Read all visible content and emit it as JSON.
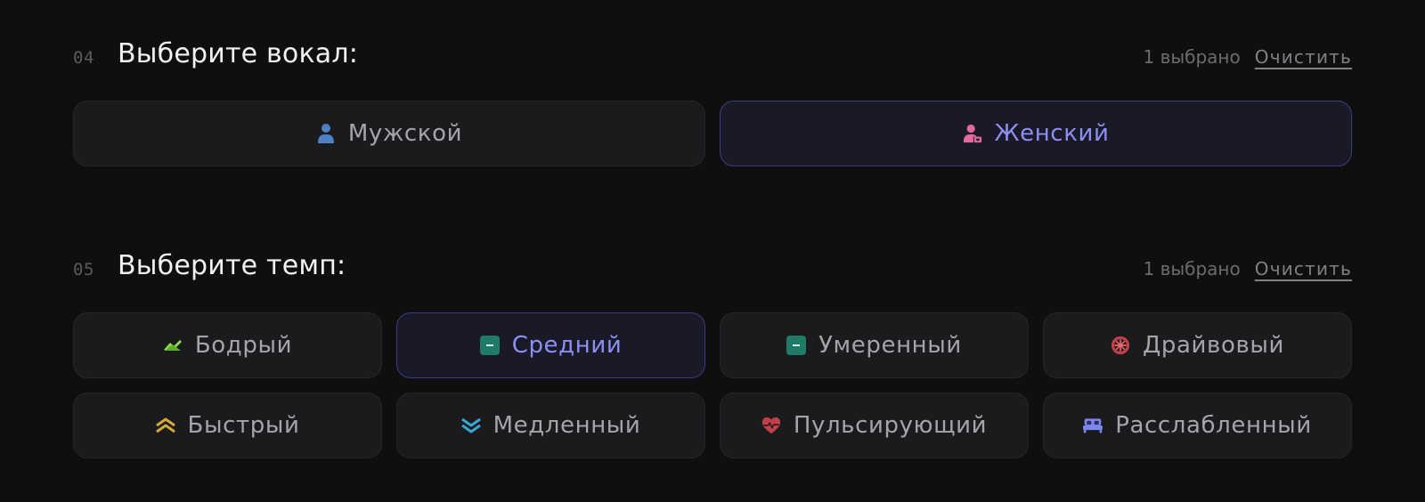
{
  "vocal": {
    "number": "04",
    "title": "Выберите вокал:",
    "count": "1 выбрано",
    "clear": "Очистить",
    "options": [
      {
        "label": "Мужской",
        "icon": "male-person-icon",
        "selected": false
      },
      {
        "label": "Женский",
        "icon": "female-person-icon",
        "selected": true
      }
    ]
  },
  "tempo": {
    "number": "05",
    "title": "Выберите темп:",
    "count": "1 выбрано",
    "clear": "Очистить",
    "options": [
      {
        "label": "Бодрый",
        "icon": "upward-trend-icon",
        "selected": false
      },
      {
        "label": "Средний",
        "icon": "minus-square-icon",
        "selected": true
      },
      {
        "label": "Умеренный",
        "icon": "minus-square-icon",
        "selected": false
      },
      {
        "label": "Драйвовый",
        "icon": "asterisk-circle-icon",
        "selected": false
      },
      {
        "label": "Быстрый",
        "icon": "double-chevron-up-icon",
        "selected": false
      },
      {
        "label": "Медленный",
        "icon": "double-chevron-down-icon",
        "selected": false
      },
      {
        "label": "Пульсирующий",
        "icon": "heart-pulse-icon",
        "selected": false
      },
      {
        "label": "Расслабленный",
        "icon": "bed-icon",
        "selected": false
      }
    ]
  },
  "colors": {
    "accent": "#8d8ff2",
    "selected_border": "#3e3c80",
    "male_icon": "#4f7fc4",
    "female_icon": "#e26aa0",
    "green_icon": "#8ee04a",
    "teal_icon": "#1f7a68",
    "red_icon": "#c0414a",
    "gold_icon": "#d6a93a",
    "blue_icon": "#36a7d6",
    "purple_icon": "#7b86f0"
  }
}
